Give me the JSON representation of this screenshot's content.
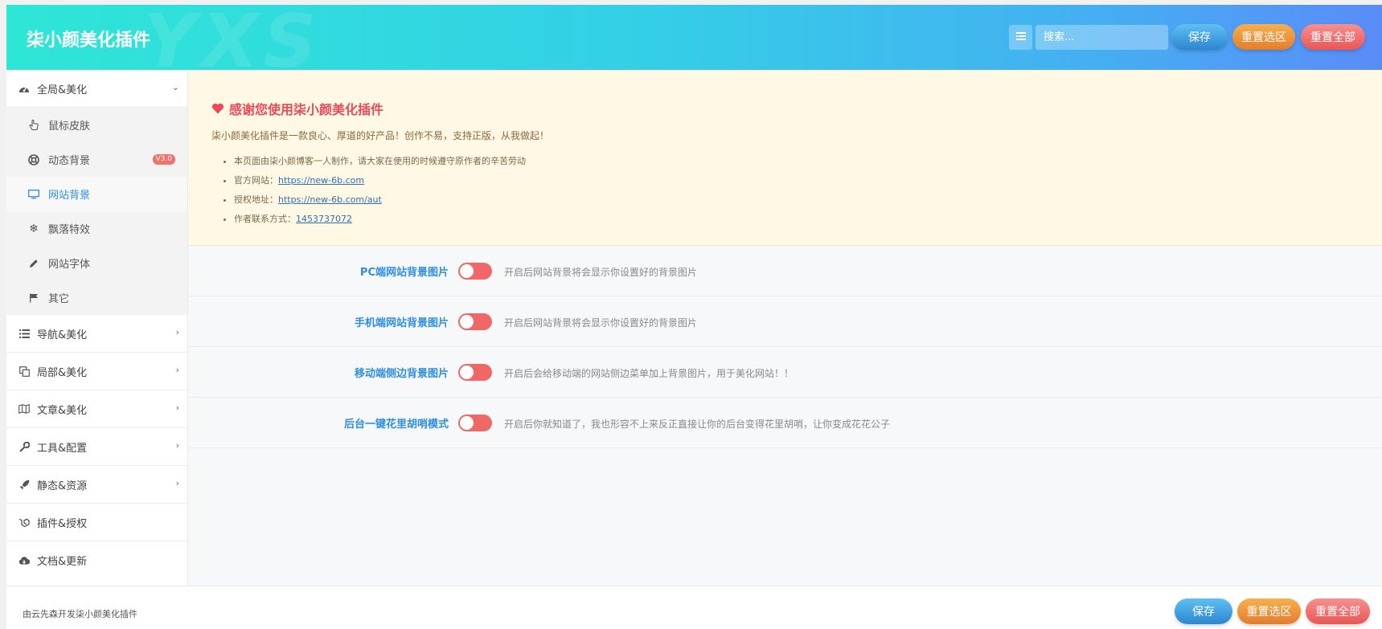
{
  "header": {
    "watermark": "YXS",
    "title": "柒小颜美化插件",
    "search_placeholder": "搜索...",
    "save_label": "保存",
    "reset_section_label": "重置选区",
    "reset_all_label": "重置全部"
  },
  "sidebar": {
    "groups": [
      {
        "label": "全局&美化",
        "icon": "dashboard-icon",
        "expanded": true
      },
      {
        "label": "导航&美化",
        "icon": "list-icon"
      },
      {
        "label": "局部&美化",
        "icon": "copy-icon"
      },
      {
        "label": "文章&美化",
        "icon": "map-icon"
      },
      {
        "label": "工具&配置",
        "icon": "wrench-icon"
      },
      {
        "label": "静态&资源",
        "icon": "rocket-icon"
      },
      {
        "label": "插件&授权",
        "icon": "laravel-icon"
      },
      {
        "label": "文档&更新",
        "icon": "cloud-download-icon"
      }
    ],
    "subitems": [
      {
        "label": "鼠标皮肤",
        "icon": "hand-pointer-icon"
      },
      {
        "label": "动态背景",
        "icon": "life-ring-icon",
        "badge": "V3.0"
      },
      {
        "label": "网站背景",
        "icon": "desktop-icon",
        "active": true
      },
      {
        "label": "飘落特效",
        "icon": "snowflake-icon"
      },
      {
        "label": "网站字体",
        "icon": "pencil-icon"
      },
      {
        "label": "其它",
        "icon": "flag-icon"
      }
    ]
  },
  "notice": {
    "title": "感谢您使用柒小颜美化插件",
    "description": "柒小颜美化插件是一款良心、厚道的好产品！创作不易，支持正版，从我做起！",
    "items": [
      {
        "text": "本页面由柒小颜博客一人制作，请大家在使用的时候遵守原作者的辛苦劳动"
      },
      {
        "text": "官方网站：",
        "link": "https://new-6b.com"
      },
      {
        "text": "授权地址：",
        "link": "https://new-6b.com/aut"
      },
      {
        "text": "作者联系方式：",
        "link": "1453737072"
      }
    ]
  },
  "fields": [
    {
      "label": "PC端网站背景图片",
      "help": "开启后网站背景将会显示你设置好的背景图片",
      "enabled": false
    },
    {
      "label": "手机端网站背景图片",
      "help": "开启后网站背景将会显示你设置好的背景图片",
      "enabled": false
    },
    {
      "label": "移动端侧边背景图片",
      "help": "开启后会给移动端的网站侧边菜单加上背景图片，用于美化网站！！",
      "enabled": false
    },
    {
      "label": "后台一键花里胡哨模式",
      "help": "开启后你就知道了，我也形容不上来反正直接让你的后台变得花里胡哨，让你变成花花公子",
      "enabled": false
    }
  ],
  "footer": {
    "credit": "由云先森开发柒小颜美化插件",
    "save_label": "保存",
    "reset_section_label": "重置选区",
    "reset_all_label": "重置全部"
  },
  "colors": {
    "accent": "#2e8ee0",
    "switch_off": "#f06767",
    "notice_bg": "#fff8e4",
    "notice_title": "#ea4a5a"
  }
}
